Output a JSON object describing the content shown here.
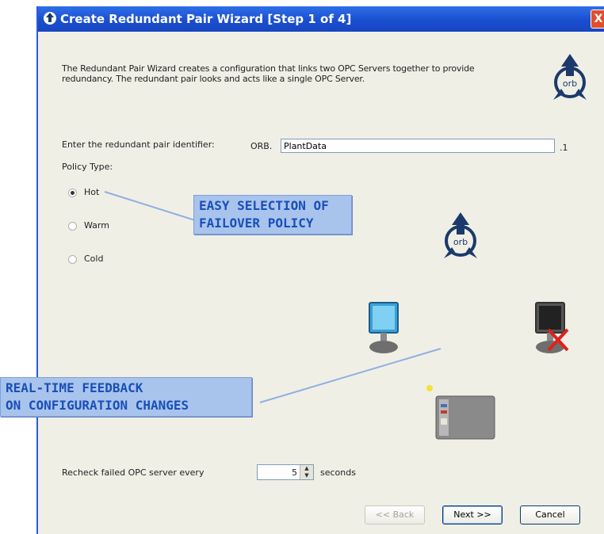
{
  "window": {
    "title": "Create Redundant Pair Wizard [Step 1 of 4]",
    "close_glyph": "X"
  },
  "intro": "The Redundant Pair Wizard creates a configuration that links two OPC Servers together to provide redundancy.  The redundant pair looks and acts like a single OPC Server.",
  "identifier": {
    "label": "Enter the redundant pair identifier:",
    "prefix": "ORB.",
    "value": "PlantData",
    "suffix": ".1"
  },
  "policy": {
    "label": "Policy Type:",
    "options": [
      {
        "label": "Hot",
        "selected": true
      },
      {
        "label": "Warm",
        "selected": false
      },
      {
        "label": "Cold",
        "selected": false
      }
    ]
  },
  "callouts": {
    "failover": [
      "EASY SELECTION OF",
      "FAILOVER POLICY"
    ],
    "feedback": [
      "REAL-TIME FEEDBACK",
      "ON CONFIGURATION CHANGES"
    ]
  },
  "logo_text": "orb",
  "recheck": {
    "label": "Recheck failed OPC server every",
    "value": "5",
    "unit": "seconds"
  },
  "buttons": {
    "back": "<< Back",
    "next": "Next >>",
    "cancel": "Cancel"
  },
  "icons": {
    "app": "orb-logo-icon",
    "pc_active": "monitor-icon",
    "pc_failed": "monitor-failed-icon",
    "server": "server-icon"
  },
  "colors": {
    "titlebar": "#1a4fd0",
    "callout_bg": "#a9c4ec",
    "callout_text": "#1a4fb8",
    "dialog_bg": "#f0efe6",
    "logo": "#1b3a6b"
  }
}
